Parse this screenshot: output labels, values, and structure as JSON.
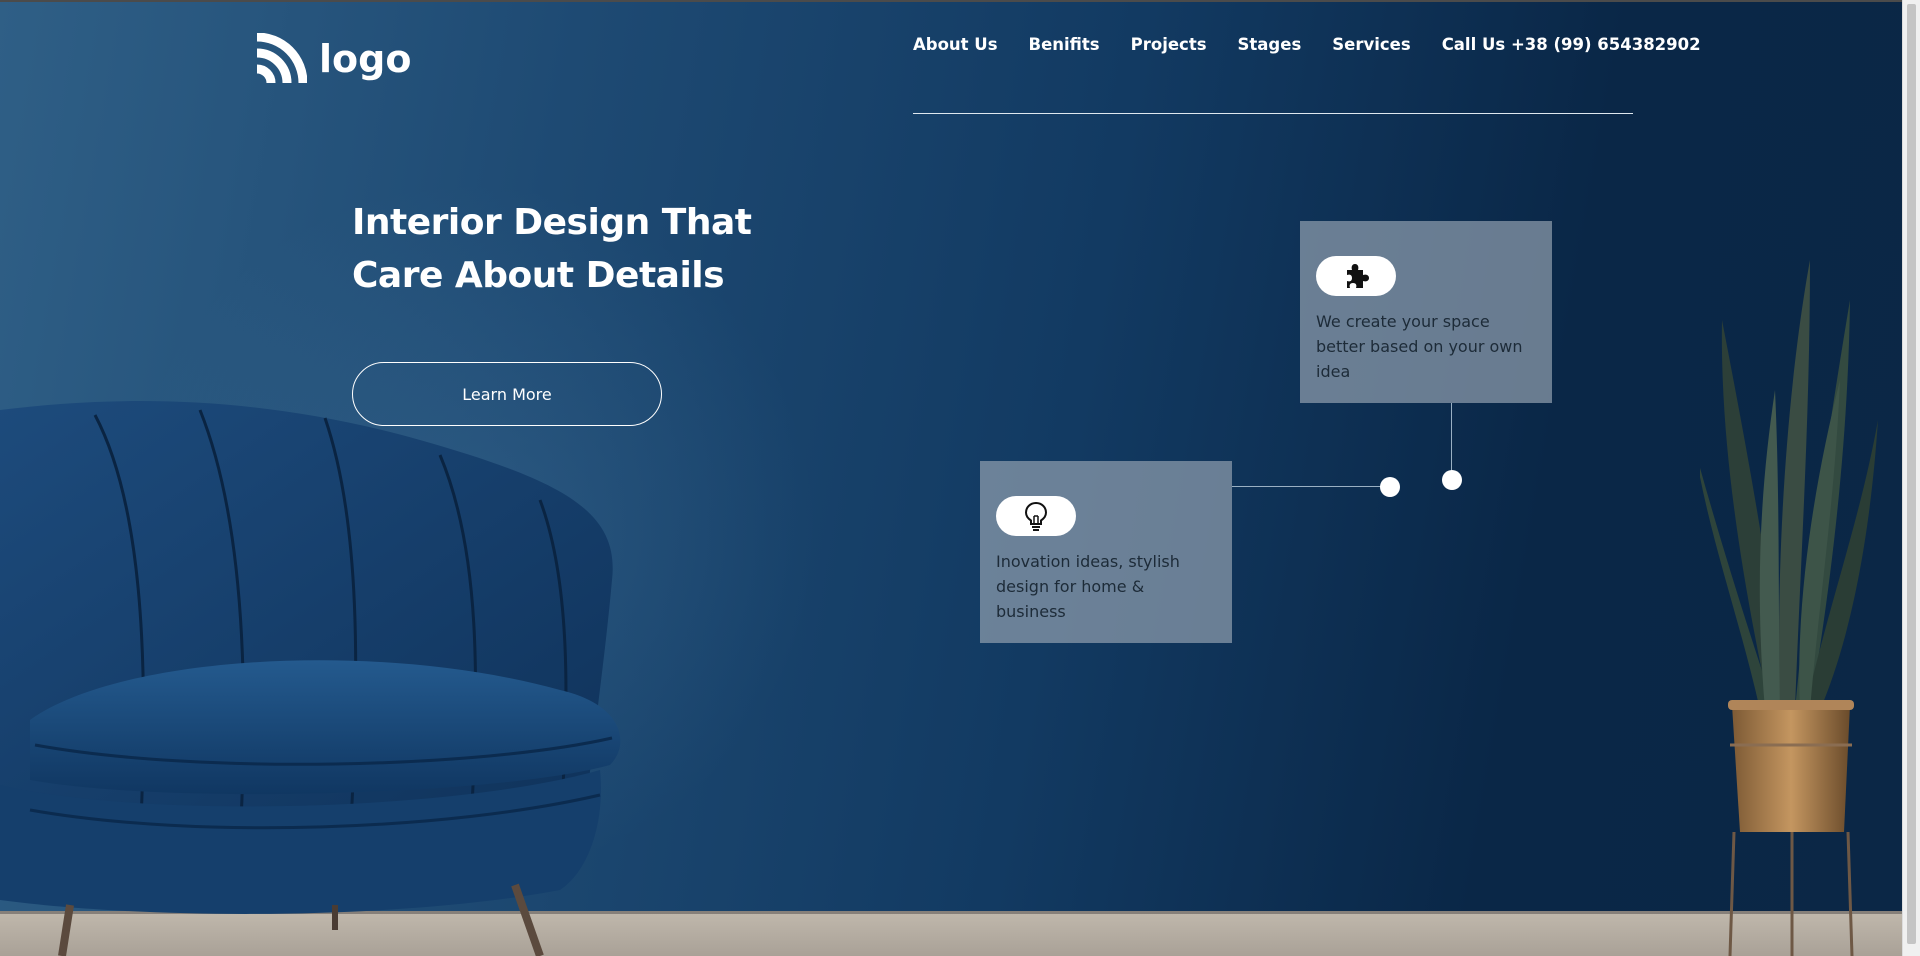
{
  "brand": {
    "logo_text": "logo"
  },
  "nav": {
    "items": [
      {
        "label": "About Us"
      },
      {
        "label": "Benifits"
      },
      {
        "label": "Projects"
      },
      {
        "label": "Stages"
      },
      {
        "label": "Services"
      }
    ],
    "call": "Call Us +38 (99) 654382902"
  },
  "hero": {
    "title_line1": "Interior Design That",
    "title_line2": "Care About Details",
    "button_label": "Learn More"
  },
  "features": [
    {
      "icon": "puzzle-icon",
      "text": "We create your space better based on your own idea"
    },
    {
      "icon": "lightbulb-icon",
      "text": "Inovation ideas, stylish design for home & business"
    }
  ],
  "colors": {
    "background_dark": "#0b2746",
    "background_light": "#2f5f86",
    "card": "#91a0af",
    "text_light": "#ffffff",
    "text_dark": "#1d2b38"
  }
}
